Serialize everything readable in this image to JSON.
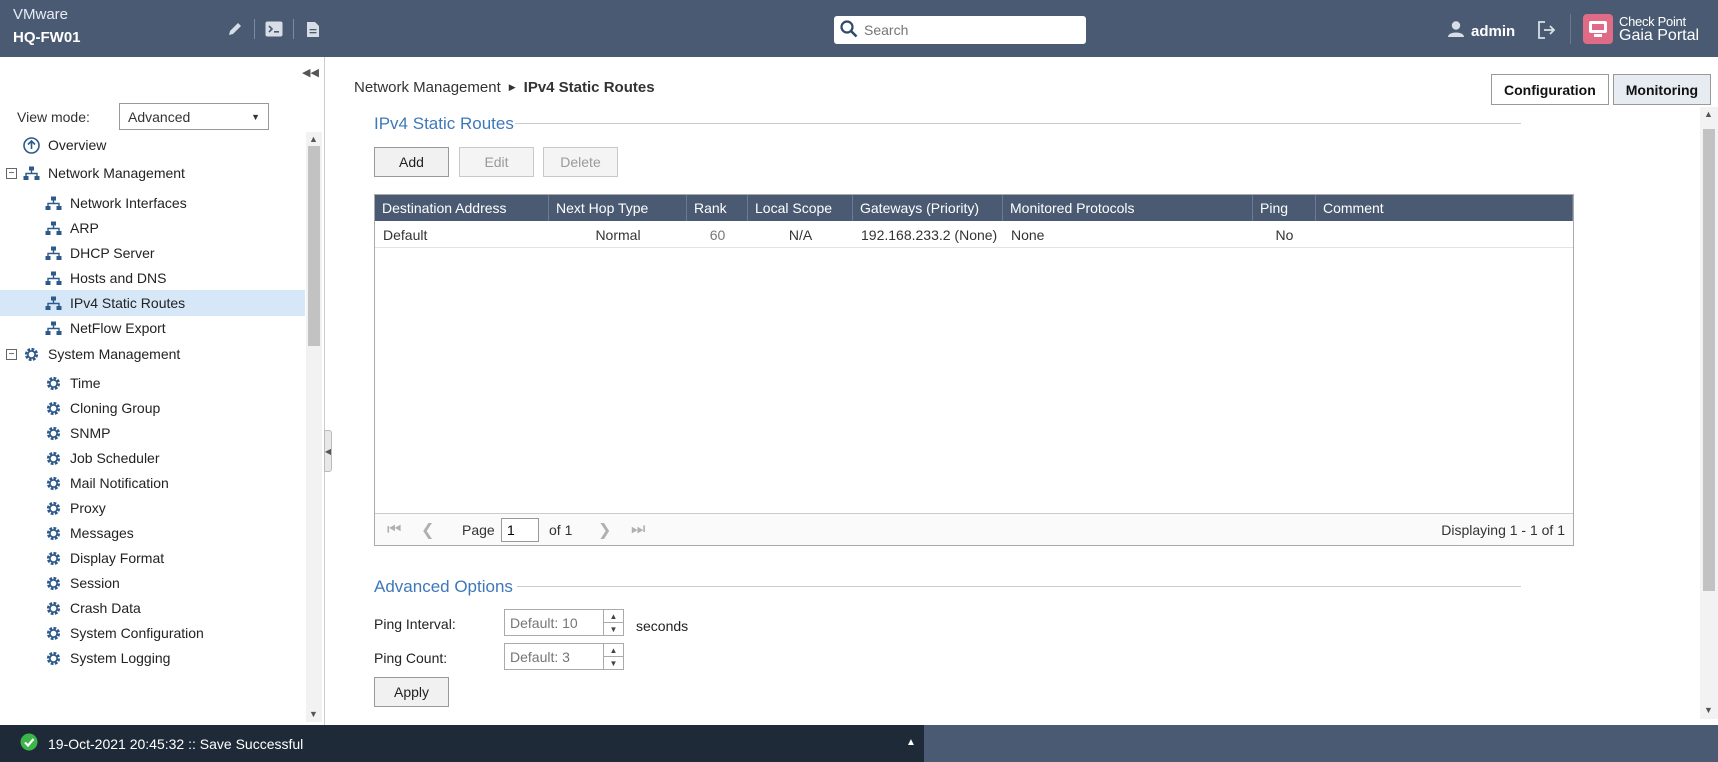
{
  "header": {
    "vm_label": "VMware",
    "hostname": "HQ-FW01",
    "search_placeholder": "Search",
    "user": "admin",
    "brand_line1": "Check Point",
    "brand_line2": "Gaia Portal",
    "accent": "#4a5a72"
  },
  "sidebar": {
    "view_mode_label": "View mode:",
    "view_mode_value": "Advanced",
    "items": [
      {
        "label": "Overview",
        "icon": "overview-icon",
        "level": 0
      },
      {
        "label": "Network Management",
        "icon": "network-icon",
        "level": 0
      },
      {
        "label": "Network Interfaces",
        "icon": "network-icon",
        "level": 1
      },
      {
        "label": "ARP",
        "icon": "network-icon",
        "level": 1
      },
      {
        "label": "DHCP Server",
        "icon": "network-icon",
        "level": 1
      },
      {
        "label": "Hosts and DNS",
        "icon": "network-icon",
        "level": 1
      },
      {
        "label": "IPv4 Static Routes",
        "icon": "network-icon",
        "level": 1
      },
      {
        "label": "NetFlow Export",
        "icon": "network-icon",
        "level": 1
      },
      {
        "label": "System Management",
        "icon": "gear-icon",
        "level": 0
      },
      {
        "label": "Time",
        "icon": "gear-icon",
        "level": 1
      },
      {
        "label": "Cloning Group",
        "icon": "gear-icon",
        "level": 1
      },
      {
        "label": "SNMP",
        "icon": "gear-icon",
        "level": 1
      },
      {
        "label": "Job Scheduler",
        "icon": "gear-icon",
        "level": 1
      },
      {
        "label": "Mail Notification",
        "icon": "gear-icon",
        "level": 1
      },
      {
        "label": "Proxy",
        "icon": "gear-icon",
        "level": 1
      },
      {
        "label": "Messages",
        "icon": "gear-icon",
        "level": 1
      },
      {
        "label": "Display Format",
        "icon": "gear-icon",
        "level": 1
      },
      {
        "label": "Session",
        "icon": "gear-icon",
        "level": 1
      },
      {
        "label": "Crash Data",
        "icon": "gear-icon",
        "level": 1
      },
      {
        "label": "System Configuration",
        "icon": "gear-icon",
        "level": 1
      },
      {
        "label": "System Logging",
        "icon": "gear-icon",
        "level": 1
      }
    ]
  },
  "main": {
    "breadcrumb": {
      "parent": "Network Management",
      "current": "IPv4 Static Routes"
    },
    "mode_buttons": {
      "configuration": "Configuration",
      "monitoring": "Monitoring"
    },
    "routes_section_title": "IPv4 Static Routes",
    "actions": {
      "add": "Add",
      "edit": "Edit",
      "delete": "Delete"
    },
    "table": {
      "columns": [
        "Destination Address",
        "Next Hop Type",
        "Rank",
        "Local Scope",
        "Gateways (Priority)",
        "Monitored Protocols",
        "Ping",
        "Comment"
      ],
      "rows": [
        [
          "Default",
          "Normal",
          "60",
          "N/A",
          "192.168.233.2 (None)",
          "None",
          "No",
          ""
        ]
      ]
    },
    "pager": {
      "page_label": "Page",
      "page_value": "1",
      "of_label": "of 1",
      "display_text": "Displaying 1 - 1 of 1"
    },
    "advanced_section_title": "Advanced Options",
    "ping_interval_label": "Ping Interval:",
    "ping_interval_placeholder": "Default: 10",
    "ping_interval_unit": "seconds",
    "ping_count_label": "Ping Count:",
    "ping_count_placeholder": "Default: 3",
    "apply": "Apply"
  },
  "status": {
    "message": "19-Oct-2021 20:45:32 :: Save Successful",
    "success_color": "#3cb54a"
  }
}
